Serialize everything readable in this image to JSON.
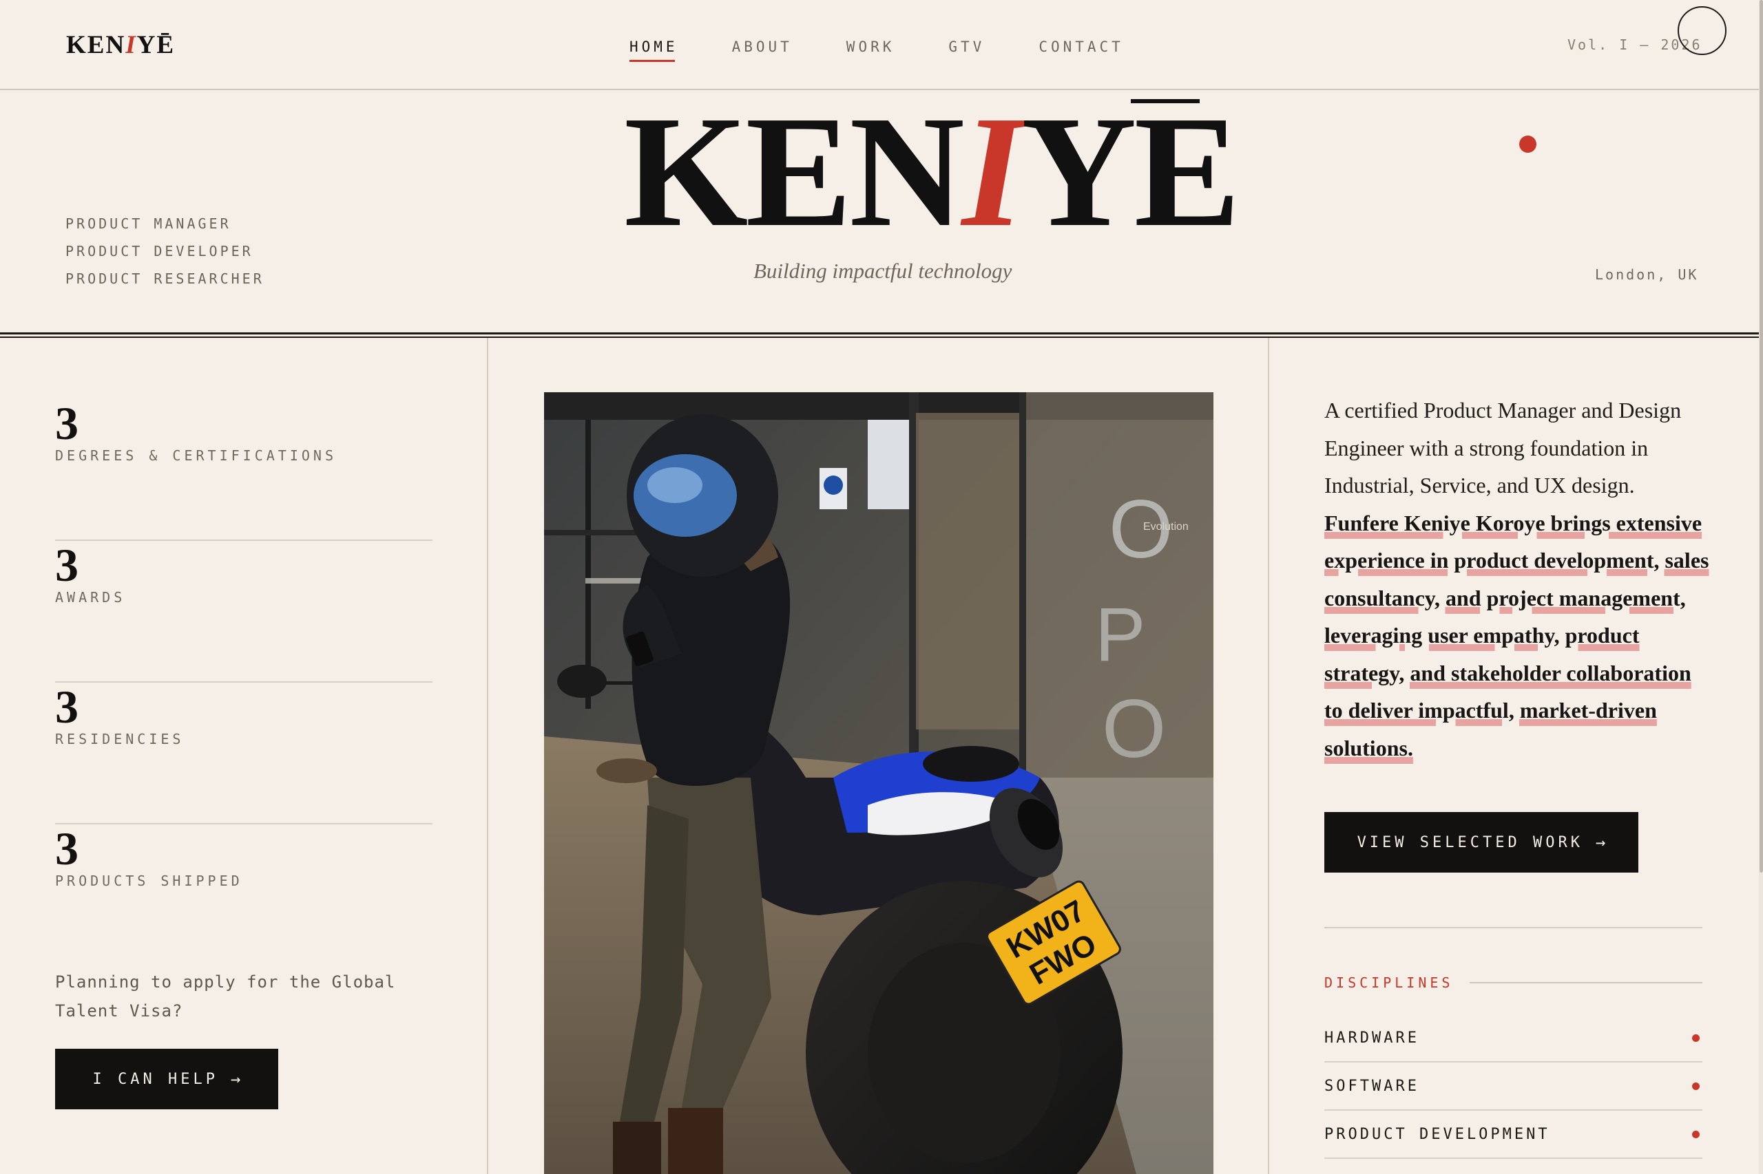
{
  "header": {
    "logo": {
      "before": "KEN",
      "slash": "I",
      "after": "YĒ"
    },
    "nav": [
      "HOME",
      "ABOUT",
      "WORK",
      "GTV",
      "CONTACT"
    ],
    "active_nav": "HOME",
    "volume": "Vol. I — 2026"
  },
  "hero": {
    "roles": [
      "PRODUCT MANAGER",
      "PRODUCT DEVELOPER",
      "PRODUCT RESEARCHER"
    ],
    "title": {
      "before": "KEN",
      "slash": "I",
      "after": "YE"
    },
    "tagline": "Building impactful technology",
    "location": "London, UK"
  },
  "stats": [
    {
      "value": "3",
      "label": "DEGREES & CERTIFICATIONS"
    },
    {
      "value": "3",
      "label": "AWARDS"
    },
    {
      "value": "3",
      "label": "RESIDENCIES"
    },
    {
      "value": "3",
      "label": "PRODUCTS SHIPPED"
    }
  ],
  "gtv": {
    "text": "Planning to apply for the Global Talent Visa?",
    "button": "I CAN HELP",
    "button_arrow": "→"
  },
  "photo": {
    "plate_line1": "KW07",
    "plate_line2": "FWO",
    "sign_text": "Evolution"
  },
  "bio": {
    "intro": "A certified Product Manager and Design Engineer with a strong foundation in Industrial, Service, and UX design. ",
    "highlight": "Funfere Keniye Koroye brings extensive experience in product development, sales consultancy, and project management, leveraging user empathy, product strategy, and stakeholder collaboration to deliver impactful, market-driven solutions."
  },
  "cta": {
    "label": "VIEW SELECTED WORK",
    "arrow": "→"
  },
  "disciplines": {
    "heading": "DISCIPLINES",
    "items": [
      "HARDWARE",
      "SOFTWARE",
      "PRODUCT DEVELOPMENT"
    ]
  },
  "colors": {
    "accent": "#c8372a",
    "background": "#f5efe7",
    "ink": "#121110"
  }
}
